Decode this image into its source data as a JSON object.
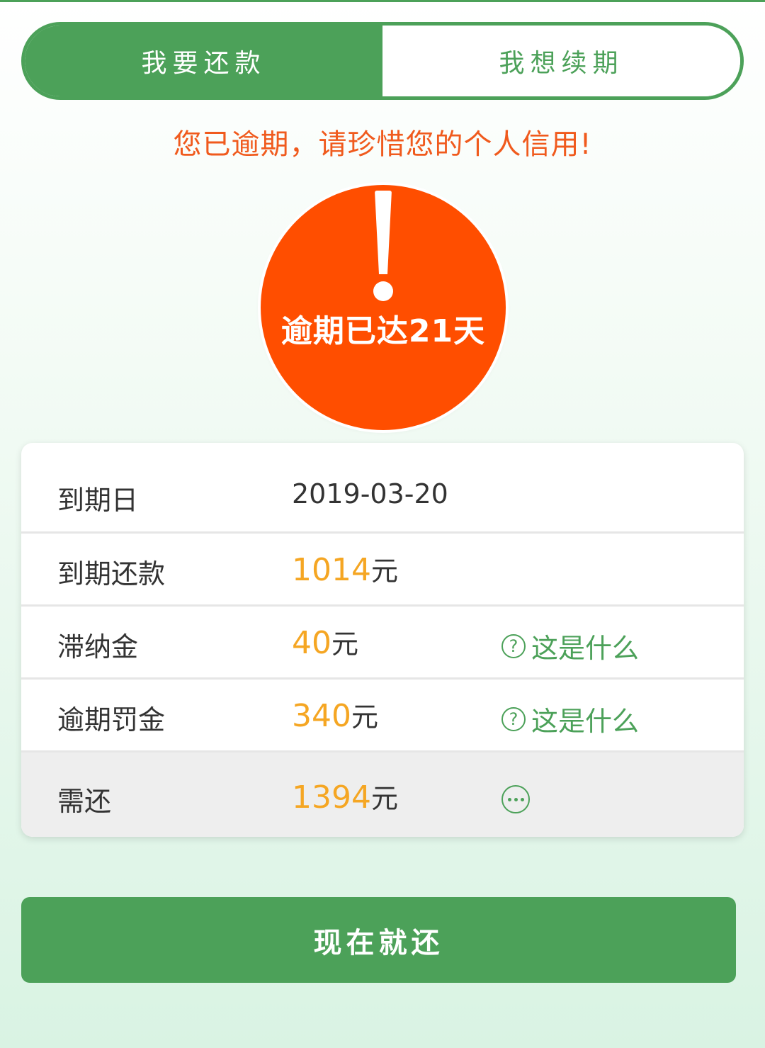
{
  "tabs": [
    {
      "label": "我要还款",
      "active": true
    },
    {
      "label": "我想续期",
      "active": false
    }
  ],
  "warning": "您已逾期，请珍惜您的个人信用!",
  "overdue_badge": {
    "text": "逾期已达21天"
  },
  "details": {
    "due_date": {
      "label": "到期日",
      "value": "2019-03-20"
    },
    "due_repayment": {
      "label": "到期还款",
      "amount": "1014",
      "unit": "元"
    },
    "late_fee": {
      "label": "滞纳金",
      "amount": "40",
      "unit": "元",
      "help": "这是什么"
    },
    "penalty": {
      "label": "逾期罚金",
      "amount": "340",
      "unit": "元",
      "help": "这是什么"
    },
    "total_due": {
      "label": "需还",
      "amount": "1394",
      "unit": "元"
    }
  },
  "pay_button_label": "现在就还",
  "colors": {
    "primary_green": "#4ca159",
    "warning_orange": "#f05a1d",
    "badge_orange": "#ff4e00",
    "amount_yellow": "#f5a623"
  },
  "icons": {
    "help": "question-circle-icon",
    "more": "more-dots-icon",
    "alert": "exclamation-icon"
  }
}
